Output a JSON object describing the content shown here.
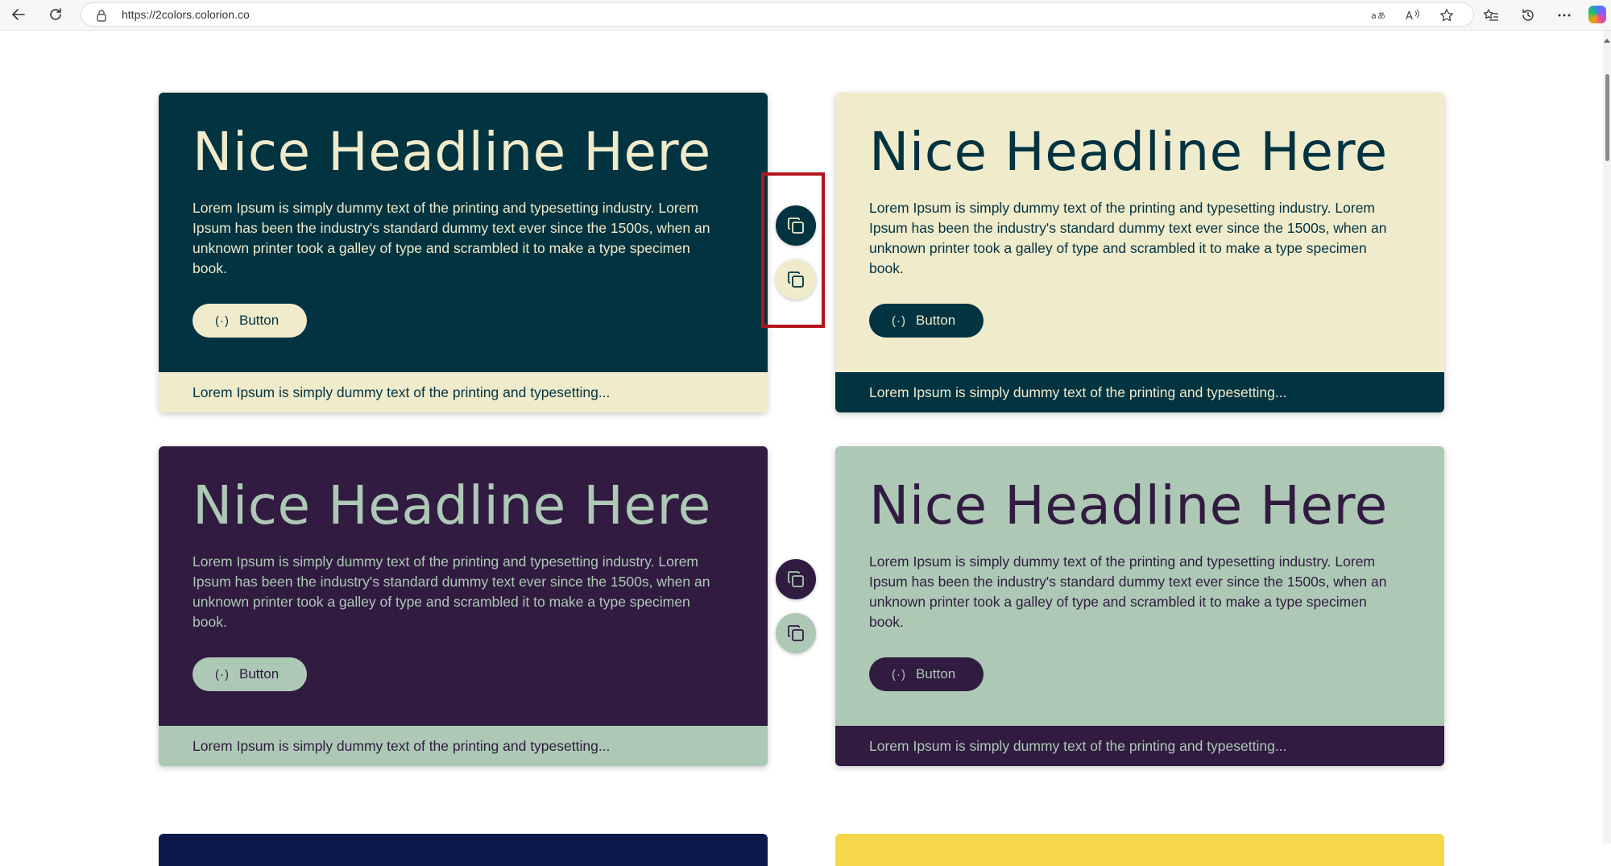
{
  "browser": {
    "url": "https://2colors.colorion.co",
    "icons": [
      "back-arrow-icon",
      "refresh-icon",
      "lock-icon",
      "translate-icon",
      "read-aloud-icon",
      "favorite-star-icon",
      "favorites-list-icon",
      "history-icon",
      "more-icon",
      "copilot-icon"
    ]
  },
  "cards": [
    {
      "headline": "Nice Headline Here",
      "body": "Lorem Ipsum is simply dummy text of the printing and typesetting industry. Lorem Ipsum has been the industry's standard dummy text ever since the 1500s, when an unknown printer took a galley of type and scrambled it to make a type specimen book.",
      "button_icon": "(·)",
      "button_label": "Button",
      "footer": "Lorem Ipsum is simply dummy text of the printing and typesetting...",
      "colors": {
        "bg": "#023341",
        "fg": "#efebcb"
      }
    },
    {
      "headline": "Nice Headline Here",
      "body": "Lorem Ipsum is simply dummy text of the printing and typesetting industry. Lorem Ipsum has been the industry's standard dummy text ever since the 1500s, when an unknown printer took a galley of type and scrambled it to make a type specimen book.",
      "button_icon": "(·)",
      "button_label": "Button",
      "footer": "Lorem Ipsum is simply dummy text of the printing and typesetting...",
      "colors": {
        "bg": "#efebcb",
        "fg": "#023341"
      }
    },
    {
      "headline": "Nice Headline Here",
      "body": "Lorem Ipsum is simply dummy text of the printing and typesetting industry. Lorem Ipsum has been the industry's standard dummy text ever since the 1500s, when an unknown printer took a galley of type and scrambled it to make a type specimen book.",
      "button_icon": "(·)",
      "button_label": "Button",
      "footer": "Lorem Ipsum is simply dummy text of the printing and typesetting...",
      "colors": {
        "bg": "#311b41",
        "fg": "#adc9b5"
      }
    },
    {
      "headline": "Nice Headline Here",
      "body": "Lorem Ipsum is simply dummy text of the printing and typesetting industry. Lorem Ipsum has been the industry's standard dummy text ever since the 1500s, when an unknown printer took a galley of type and scrambled it to make a type specimen book.",
      "button_icon": "(·)",
      "button_label": "Button",
      "footer": "Lorem Ipsum is simply dummy text of the printing and typesetting...",
      "colors": {
        "bg": "#adc9b5",
        "fg": "#311b41"
      }
    }
  ],
  "copy_buttons": [
    {
      "icon": "copy-icon",
      "color": "#023341"
    },
    {
      "icon": "copy-icon",
      "color": "#efebcb"
    },
    {
      "icon": "copy-icon",
      "color": "#311b41"
    },
    {
      "icon": "copy-icon",
      "color": "#adc9b5"
    }
  ],
  "partial_cards": [
    {
      "color": "#0b1a4a"
    },
    {
      "color": "#f6d64a"
    }
  ],
  "highlight_color": "#b3141c"
}
